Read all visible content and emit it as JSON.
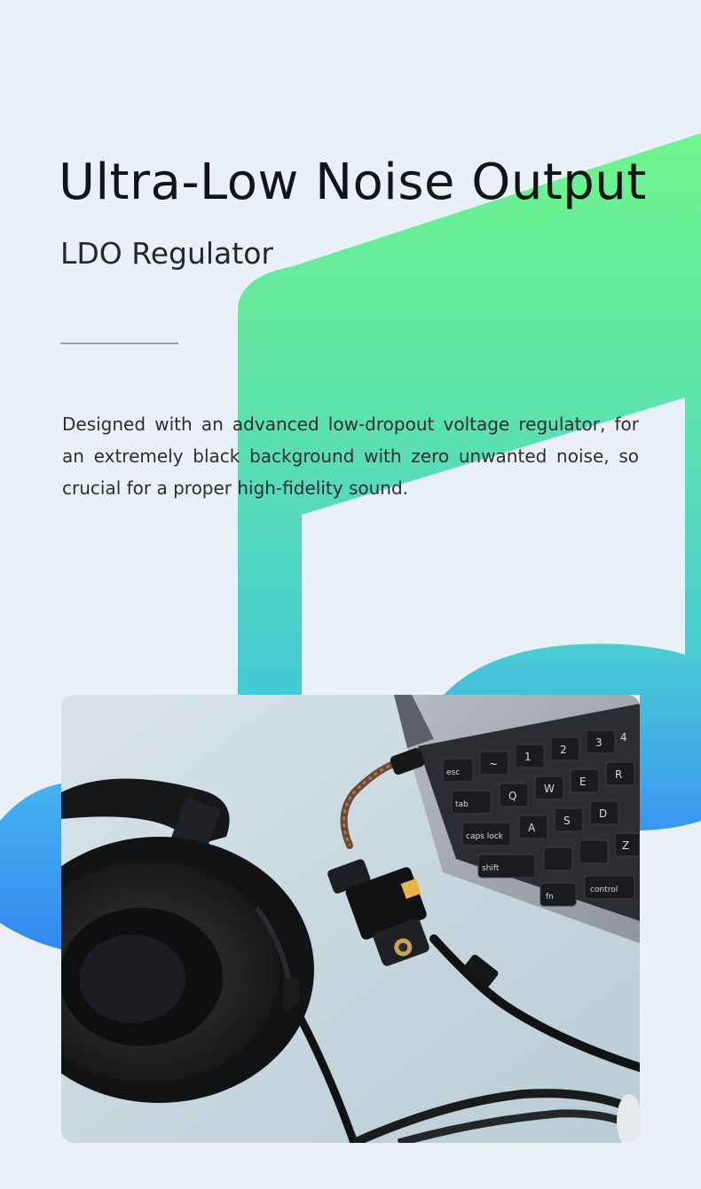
{
  "header": {
    "title": "Ultra-Low Noise Output",
    "subtitle": "LDO Regulator"
  },
  "body": {
    "description": "Designed with an advanced low-dropout voltage regulator, for an extremely black background with zero unwanted noise, so crucial for a proper high-fidelity sound."
  },
  "photo": {
    "keyboard_labels": [
      "esc",
      "tab",
      "caps lock",
      "shift",
      "fn",
      "control"
    ],
    "keys": [
      "~",
      "1",
      "2",
      "3",
      "4",
      "Q",
      "W",
      "E",
      "R",
      "A",
      "S",
      "D",
      "Z"
    ]
  },
  "colors": {
    "background": "#e9f0f7",
    "green": "#6df08f",
    "teal": "#4fd2cc",
    "blue": "#3a98f2",
    "text": "#111418"
  }
}
